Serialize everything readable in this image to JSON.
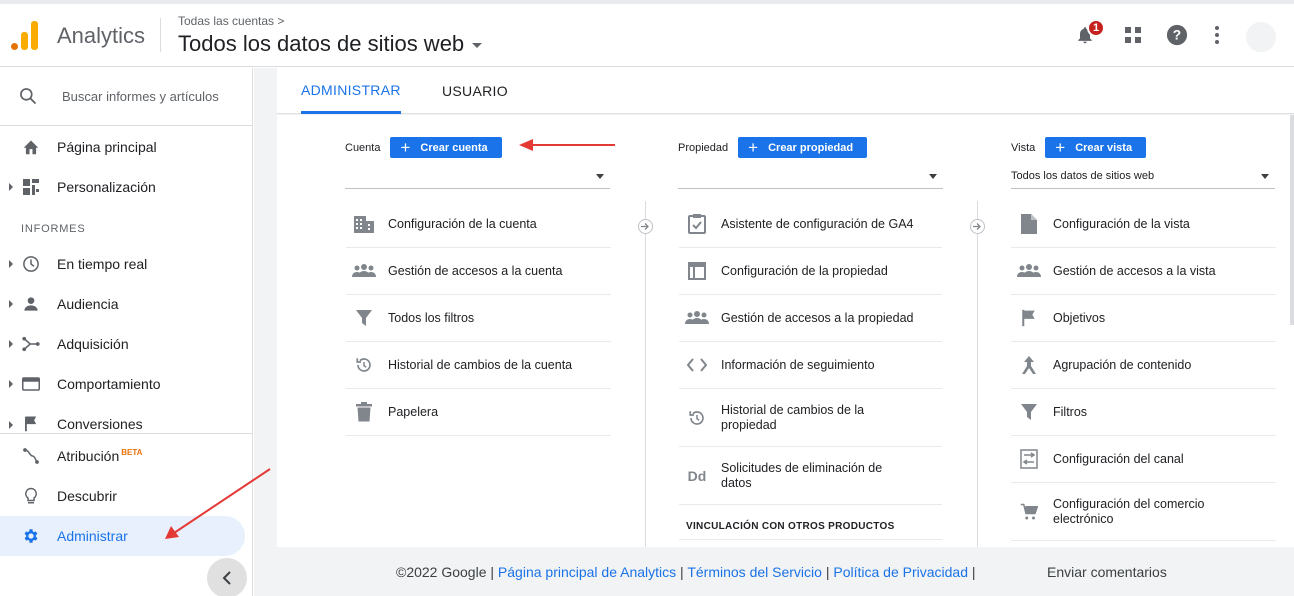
{
  "header": {
    "brand": "Analytics",
    "breadcrumb": "Todas las cuentas >",
    "view_title": "Todos los datos de sitios web",
    "notification_count": "1"
  },
  "sidebar": {
    "search_placeholder": "Buscar informes y artículos",
    "items": [
      {
        "label": "Página principal",
        "icon": "home-icon"
      },
      {
        "label": "Personalización",
        "icon": "dashboard-icon"
      },
      {
        "label": "En tiempo real",
        "icon": "clock-icon"
      },
      {
        "label": "Audiencia",
        "icon": "person-icon"
      },
      {
        "label": "Adquisición",
        "icon": "acquisition-icon"
      },
      {
        "label": "Comportamiento",
        "icon": "behavior-icon"
      },
      {
        "label": "Conversiones",
        "icon": "flag-icon"
      },
      {
        "label": "Atribución",
        "icon": "attribution-icon"
      },
      {
        "label": "Descubrir",
        "icon": "lightbulb-icon"
      },
      {
        "label": "Administrar",
        "icon": "gear-icon"
      }
    ],
    "section_label": "INFORMES",
    "beta_label": "BETA"
  },
  "tabs": {
    "admin": "ADMINISTRAR",
    "user": "USUARIO"
  },
  "columns": {
    "account": {
      "label": "Cuenta",
      "button": "Crear cuenta",
      "selected": "",
      "items": [
        "Configuración de la cuenta",
        "Gestión de accesos a la cuenta",
        "Todos los filtros",
        "Historial de cambios de la cuenta",
        "Papelera"
      ]
    },
    "property": {
      "label": "Propiedad",
      "button": "Crear propiedad",
      "selected": "",
      "items": [
        "Asistente de configuración de GA4",
        "Configuración de la propiedad",
        "Gestión de accesos a la propiedad",
        "Información de seguimiento",
        "Historial de cambios de la propiedad",
        "Solicitudes de eliminación de datos"
      ],
      "linking_heading": "VINCULACIÓN CON OTROS PRODUCTOS"
    },
    "view": {
      "label": "Vista",
      "button": "Crear vista",
      "selected": "Todos los datos de sitios web",
      "items": [
        "Configuración de la vista",
        "Gestión de accesos a la vista",
        "Objetivos",
        "Agrupación de contenido",
        "Filtros",
        "Configuración del canal",
        "Configuración del comercio electrónico"
      ]
    }
  },
  "footer": {
    "copyright": "©2022 Google |",
    "link_home": "Página principal de Analytics",
    "sep1": "|",
    "link_terms": "Términos del Servicio",
    "sep2": "|",
    "link_privacy": "Política de Privacidad",
    "sep3": "|",
    "feedback": "Enviar comentarios"
  },
  "colors": {
    "accent": "#1a73e8",
    "logo_orange": "#e37400",
    "logo_yellow": "#f9ab00",
    "badge_red": "#c5221f",
    "arrow_red": "#e53935"
  }
}
